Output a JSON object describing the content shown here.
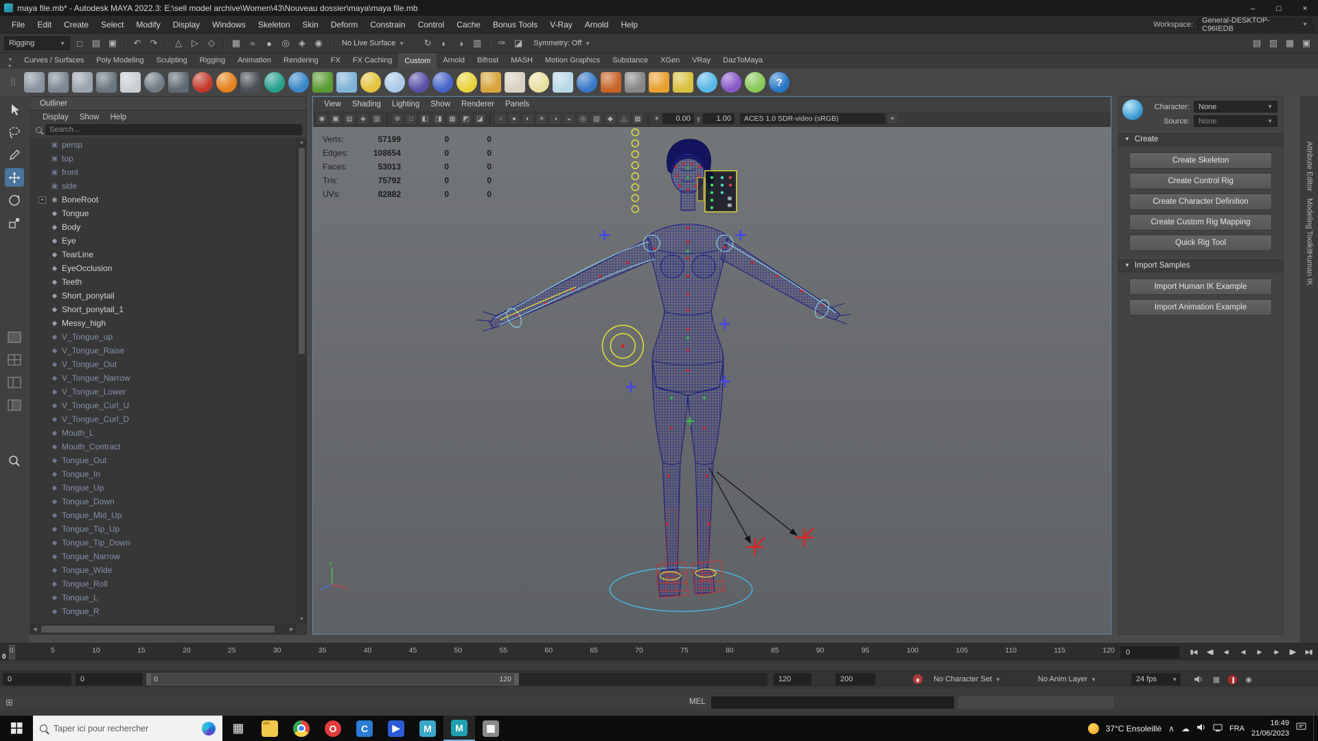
{
  "titlebar": {
    "title": "maya file.mb* - Autodesk MAYA 2022.3: E:\\sell model archive\\Women\\43\\Nouveau dossier\\maya\\maya file.mb",
    "minimize": "–",
    "maximize": "□",
    "close": "×"
  },
  "menubar": {
    "items": [
      "File",
      "Edit",
      "Create",
      "Select",
      "Modify",
      "Display",
      "Windows",
      "Skeleton",
      "Skin",
      "Deform",
      "Constrain",
      "Control",
      "Cache",
      "Bonus Tools",
      "V-Ray",
      "Arnold",
      "Help"
    ],
    "workspace_label": "Workspace:",
    "workspace_value": "General-DESKTOP-C96IEDB"
  },
  "statusline": {
    "menuset": "Rigging",
    "live_surface": "No Live Surface",
    "symmetry": "Symmetry: Off",
    "icons": [
      {
        "name": "new-scene-icon",
        "glyph": "□"
      },
      {
        "name": "open-scene-icon",
        "glyph": "▤"
      },
      {
        "name": "save-scene-icon",
        "glyph": "▣"
      },
      {
        "divider": true
      },
      {
        "name": "undo-icon",
        "glyph": "↶"
      },
      {
        "name": "redo-icon",
        "glyph": "↷"
      },
      {
        "divider": true
      },
      {
        "name": "select-hierarchy-icon",
        "glyph": "△"
      },
      {
        "name": "select-object-icon",
        "glyph": "▷"
      },
      {
        "name": "select-component-icon",
        "glyph": "◇"
      },
      {
        "divider": true
      },
      {
        "name": "snap-grid-icon",
        "glyph": "▦"
      },
      {
        "name": "snap-curve-icon",
        "glyph": "≈"
      },
      {
        "name": "snap-point-icon",
        "glyph": "●"
      },
      {
        "name": "snap-projected-center-icon",
        "glyph": "◎"
      },
      {
        "name": "snap-view-plane-icon",
        "glyph": "◈"
      },
      {
        "name": "make-live-icon",
        "glyph": "◉"
      },
      {
        "divider": true
      }
    ],
    "icons2": [
      {
        "divider": true
      },
      {
        "name": "construction-history-icon",
        "glyph": "↻"
      },
      {
        "name": "render-current-frame-icon",
        "glyph": "◐"
      },
      {
        "name": "ipr-render-icon",
        "glyph": "◑"
      },
      {
        "name": "render-settings-icon",
        "glyph": "▥"
      },
      {
        "divider": true
      },
      {
        "name": "paint-effects-icon",
        "glyph": "✑"
      },
      {
        "name": "hypershade-icon",
        "glyph": "◪"
      }
    ],
    "right_icons": [
      {
        "name": "raise-application-toggle-icon",
        "glyph": "▤"
      },
      {
        "name": "attribute-editor-toggle-icon",
        "glyph": "▥"
      },
      {
        "name": "tool-settings-toggle-icon",
        "glyph": "▦"
      },
      {
        "name": "channel-box-toggle-icon",
        "glyph": "▣"
      }
    ]
  },
  "shelf": {
    "tabs": [
      "Curves / Surfaces",
      "Poly Modeling",
      "Sculpting",
      "Rigging",
      "Animation",
      "Rendering",
      "FX",
      "FX Caching",
      "Custom",
      "Arnold",
      "Bifrost",
      "MASH",
      "Motion Graphics",
      "Substance",
      "XGen",
      "VRay",
      "DazToMaya"
    ],
    "active_tab": "Custom",
    "icons": [
      {
        "name": "poly-text-icon",
        "color": "#8a94a0",
        "shape": "square"
      },
      {
        "name": "poly-type-icon",
        "color": "#7e8894",
        "shape": "square"
      },
      {
        "name": "graph-editor-icon",
        "color": "#9aa4ae",
        "shape": "square"
      },
      {
        "name": "uv-editor-icon",
        "color": "#6b7680",
        "shape": "square"
      },
      {
        "name": "notes-icon",
        "color": "#c9ced3",
        "shape": "square"
      },
      {
        "name": "gray-sphere-icon",
        "color": "#707b85",
        "shape": "circle"
      },
      {
        "name": "wedge-icon",
        "color": "#5e6973",
        "shape": "square"
      },
      {
        "name": "red-ball-icon",
        "color": "#c2392b",
        "shape": "circle"
      },
      {
        "name": "fire-icon",
        "color": "#e6821e",
        "shape": "circle"
      },
      {
        "name": "camera-shelf-icon",
        "color": "#4a4f54",
        "shape": "square"
      },
      {
        "name": "ocean-icon",
        "color": "#27a08c",
        "shape": "circle"
      },
      {
        "name": "pond-icon",
        "color": "#3a87c8",
        "shape": "circle"
      },
      {
        "name": "grass-icon",
        "color": "#5a9a33",
        "shape": "square"
      },
      {
        "name": "fluid-icon",
        "color": "#7fb3d8",
        "shape": "square"
      },
      {
        "name": "flower-icon",
        "color": "#e3c43c",
        "shape": "circle"
      },
      {
        "name": "dandelion-icon",
        "color": "#a8c8e8",
        "shape": "circle"
      },
      {
        "name": "nparticle-icon",
        "color": "#5a50a8",
        "shape": "circle"
      },
      {
        "name": "balloon-icon",
        "color": "#4664c8",
        "shape": "circle"
      },
      {
        "name": "lemon-icon",
        "color": "#e8d23c",
        "shape": "circle"
      },
      {
        "name": "funnel-icon",
        "color": "#d8a43c",
        "shape": "square"
      },
      {
        "name": "cone-icon",
        "color": "#d8d0c0",
        "shape": "square"
      },
      {
        "name": "sparkle-icon",
        "color": "#e8e0a0",
        "shape": "circle"
      },
      {
        "name": "glass-icon",
        "color": "#b8d8e8",
        "shape": "square"
      },
      {
        "name": "shaderball-icon",
        "color": "#3878c8",
        "shape": "circle"
      },
      {
        "name": "column-chart-icon",
        "color": "#c86428",
        "shape": "square"
      },
      {
        "name": "checker-icon",
        "color": "#888888",
        "shape": "square"
      },
      {
        "name": "render-cam-icon",
        "color": "#e8a030",
        "shape": "square"
      },
      {
        "name": "pencil-icon",
        "color": "#d8c040",
        "shape": "square"
      },
      {
        "name": "cloud-shelf-icon",
        "color": "#58b8e8",
        "shape": "circle"
      },
      {
        "name": "violet-ball-icon",
        "color": "#8858c8",
        "shape": "circle"
      },
      {
        "name": "dots-icon",
        "color": "#88c858",
        "shape": "circle"
      },
      {
        "name": "help-icon",
        "color": "#2878c8",
        "shape": "circle",
        "glyph": "?"
      }
    ]
  },
  "toolbox": {
    "tools": [
      "select-tool",
      "lasso-tool",
      "paint-select-tool",
      "move-tool",
      "rotate-tool",
      "scale-tool"
    ],
    "layouts": [
      "layout-single-pane",
      "layout-four-pane",
      "layout-two-pane",
      "layout-outliner-persp"
    ],
    "zoom": "zoom-tool"
  },
  "outliner": {
    "title": "Outliner",
    "menus": [
      "Display",
      "Show",
      "Help"
    ],
    "search_placeholder": "Search...",
    "items": [
      {
        "label": "persp",
        "type": "camera",
        "dim": true
      },
      {
        "label": "top",
        "type": "camera",
        "dim": true
      },
      {
        "label": "front",
        "type": "camera",
        "dim": true
      },
      {
        "label": "side",
        "type": "camera",
        "dim": true
      },
      {
        "label": "BoneRoot",
        "type": "joint",
        "dim": false,
        "expand": true
      },
      {
        "label": "Tongue",
        "type": "mesh",
        "dim": false
      },
      {
        "label": "Body",
        "type": "mesh",
        "dim": false
      },
      {
        "label": "Eye",
        "type": "mesh",
        "dim": false
      },
      {
        "label": "TearLine",
        "type": "mesh",
        "dim": false
      },
      {
        "label": "EyeOcclusion",
        "type": "mesh",
        "dim": false
      },
      {
        "label": "Teeth",
        "type": "mesh",
        "dim": false
      },
      {
        "label": "Short_ponytail",
        "type": "mesh",
        "dim": false
      },
      {
        "label": "Short_ponytail_1",
        "type": "mesh",
        "dim": false
      },
      {
        "label": "Messy_high",
        "type": "mesh",
        "dim": false
      },
      {
        "label": "V_Tongue_up",
        "type": "mesh",
        "dim": true
      },
      {
        "label": "V_Tongue_Raise",
        "type": "mesh",
        "dim": true
      },
      {
        "label": "V_Tongue_Out",
        "type": "mesh",
        "dim": true
      },
      {
        "label": "V_Tongue_Narrow",
        "type": "mesh",
        "dim": true
      },
      {
        "label": "V_Tongue_Lower",
        "type": "mesh",
        "dim": true
      },
      {
        "label": "V_Tongue_Curl_U",
        "type": "mesh",
        "dim": true
      },
      {
        "label": "V_Tongue_Curl_D",
        "type": "mesh",
        "dim": true
      },
      {
        "label": "Mouth_L",
        "type": "mesh",
        "dim": true
      },
      {
        "label": "Mouth_Contract",
        "type": "mesh",
        "dim": true
      },
      {
        "label": "Tongue_Out",
        "type": "mesh",
        "dim": true
      },
      {
        "label": "Tongue_In",
        "type": "mesh",
        "dim": true
      },
      {
        "label": "Tongue_Up",
        "type": "mesh",
        "dim": true
      },
      {
        "label": "Tongue_Down",
        "type": "mesh",
        "dim": true
      },
      {
        "label": "Tongue_Mid_Up",
        "type": "mesh",
        "dim": true
      },
      {
        "label": "Tongue_Tip_Up",
        "type": "mesh",
        "dim": true
      },
      {
        "label": "Tongue_Tip_Down",
        "type": "mesh",
        "dim": true
      },
      {
        "label": "Tongue_Narrow",
        "type": "mesh",
        "dim": true
      },
      {
        "label": "Tongue_Wide",
        "type": "mesh",
        "dim": true
      },
      {
        "label": "Tongue_Roll",
        "type": "mesh",
        "dim": true
      },
      {
        "label": "Tongue_L",
        "type": "mesh",
        "dim": true
      },
      {
        "label": "Tongue_R",
        "type": "mesh",
        "dim": true
      }
    ]
  },
  "viewport": {
    "menus": [
      "View",
      "Shading",
      "Lighting",
      "Show",
      "Renderer",
      "Panels"
    ],
    "toolbar_icons": [
      {
        "name": "select-camera-icon",
        "glyph": "◉"
      },
      {
        "name": "lock-camera-icon",
        "glyph": "▣"
      },
      {
        "name": "camera-attributes-icon",
        "glyph": "▤"
      },
      {
        "name": "bookmarks-icon",
        "glyph": "◈"
      },
      {
        "name": "image-plane-icon",
        "glyph": "▥"
      },
      {
        "divider": true
      },
      {
        "name": "two-d-pan-zoom-icon",
        "glyph": "⊕"
      },
      {
        "name": "oversc an-icon",
        "glyph": "□"
      },
      {
        "name": "resolution-gate-icon",
        "glyph": "◧"
      },
      {
        "name": "gate-mask-icon",
        "glyph": "◨"
      },
      {
        "name": "field-chart-icon",
        "glyph": "▦"
      },
      {
        "name": "safe-action-icon",
        "glyph": "◩"
      },
      {
        "name": "safe-title-icon",
        "glyph": "◪"
      },
      {
        "divider": true
      },
      {
        "name": "wireframe-icon",
        "glyph": "○"
      },
      {
        "name": "shaded-icon",
        "glyph": "●"
      },
      {
        "name": "textured-icon",
        "glyph": "◐"
      },
      {
        "name": "use-all-lights-icon",
        "glyph": "☀"
      },
      {
        "name": "shadows-icon",
        "glyph": "◑"
      },
      {
        "name": "screen-space-ao-icon",
        "glyph": "◒"
      },
      {
        "name": "motion-blur-icon",
        "glyph": "◎"
      },
      {
        "name": "multisample-icon",
        "glyph": "▧"
      },
      {
        "name": "depth-of-field-icon",
        "glyph": "◆"
      },
      {
        "name": "isolate-select-icon",
        "glyph": "△"
      },
      {
        "name": "grid-toggle-icon",
        "glyph": "▦"
      },
      {
        "divider": true
      }
    ],
    "exposure_icon": "☀",
    "exposure_value": "0.00",
    "gamma_icon": "γ",
    "gamma_value": "1.00",
    "colorspace": "ACES 1.0 SDR-video (sRGB)",
    "hud_rows": [
      {
        "label": "Verts:",
        "v1": "57199",
        "v2": "0",
        "v3": "0"
      },
      {
        "label": "Edges:",
        "v1": "108654",
        "v2": "0",
        "v3": "0"
      },
      {
        "label": "Faces:",
        "v1": "53013",
        "v2": "0",
        "v3": "0"
      },
      {
        "label": "Tris:",
        "v1": "75792",
        "v2": "0",
        "v3": "0"
      },
      {
        "label": "UVs:",
        "v1": "82882",
        "v2": "0",
        "v3": "0"
      }
    ]
  },
  "humanik": {
    "character_label": "Character:",
    "character_value": "None",
    "source_label": "Source:",
    "source_value": "None",
    "create_title": "Create",
    "create_buttons": [
      "Create Skeleton",
      "Create Control Rig",
      "Create Character Definition",
      "Create Custom Rig Mapping",
      "Quick Rig Tool"
    ],
    "import_title": "Import Samples",
    "import_buttons": [
      "Import Human IK Example",
      "Import Animation Example"
    ]
  },
  "side_tabs": [
    "Attribute Editor",
    "Modeling Toolkit",
    "Human IK"
  ],
  "timeline": {
    "ticks": [
      "0",
      "5",
      "10",
      "15",
      "20",
      "25",
      "30",
      "35",
      "40",
      "45",
      "50",
      "55",
      "60",
      "65",
      "70",
      "75",
      "80",
      "85",
      "90",
      "95",
      "100",
      "105",
      "110",
      "115",
      "120"
    ],
    "playhead_label": "0",
    "frame_field": "0",
    "playback": [
      {
        "name": "go-to-start-icon",
        "glyph": "▮◀"
      },
      {
        "name": "step-back-frame-icon",
        "glyph": "◀▮"
      },
      {
        "name": "step-back-key-icon",
        "glyph": "◀·"
      },
      {
        "name": "play-backwards-icon",
        "glyph": "◀"
      },
      {
        "name": "play-forwards-icon",
        "glyph": "▶"
      },
      {
        "name": "step-forward-key-icon",
        "glyph": "·▶"
      },
      {
        "name": "step-forward-frame-icon",
        "glyph": "▮▶"
      },
      {
        "name": "go-to-end-icon",
        "glyph": "▶▮"
      }
    ]
  },
  "range": {
    "start_field": "0",
    "anim_start_field": "0",
    "range_start_label": "0",
    "range_end_label": "120",
    "end_field": "120",
    "anim_end_field": "200",
    "character_set": "No Character Set",
    "anim_layer": "No Anim Layer",
    "fps": "24 fps",
    "right_icons": [
      "mute-icon",
      "clamp-icon",
      "auto-key-icon",
      "animation-prefs-icon"
    ]
  },
  "command": {
    "mel_label": "MEL"
  },
  "helpline": {
    "grid_icon": "⊞"
  },
  "taskbar": {
    "search_placeholder": "Taper ici pour rechercher",
    "apps": [
      {
        "name": "task-view",
        "color": "transparent",
        "glyph": "▦"
      },
      {
        "name": "file-explorer",
        "color": "#f2c94c"
      },
      {
        "name": "chrome",
        "color": "#4285f4"
      },
      {
        "name": "opera",
        "color": "#e23c3c",
        "glyph": "O"
      },
      {
        "name": "blue-circle-app",
        "color": "#2b7cd3",
        "glyph": "C"
      },
      {
        "name": "video-app",
        "color": "#2b5cd3",
        "glyph": "▶"
      },
      {
        "name": "maya-file-app",
        "color": "#3ba7c8",
        "glyph": "M"
      },
      {
        "name": "maya",
        "color": "#20a0b0",
        "glyph": "M",
        "active": true
      },
      {
        "name": "image-app",
        "color": "#8a8a8a",
        "glyph": "▦"
      }
    ],
    "tray": {
      "weather_text": "37°C Ensoleillé",
      "hidden_icons_chevron": "∧",
      "cloud_icon": "☁",
      "lang": "FRA",
      "time": "16:49",
      "date": "21/06/2023"
    }
  }
}
